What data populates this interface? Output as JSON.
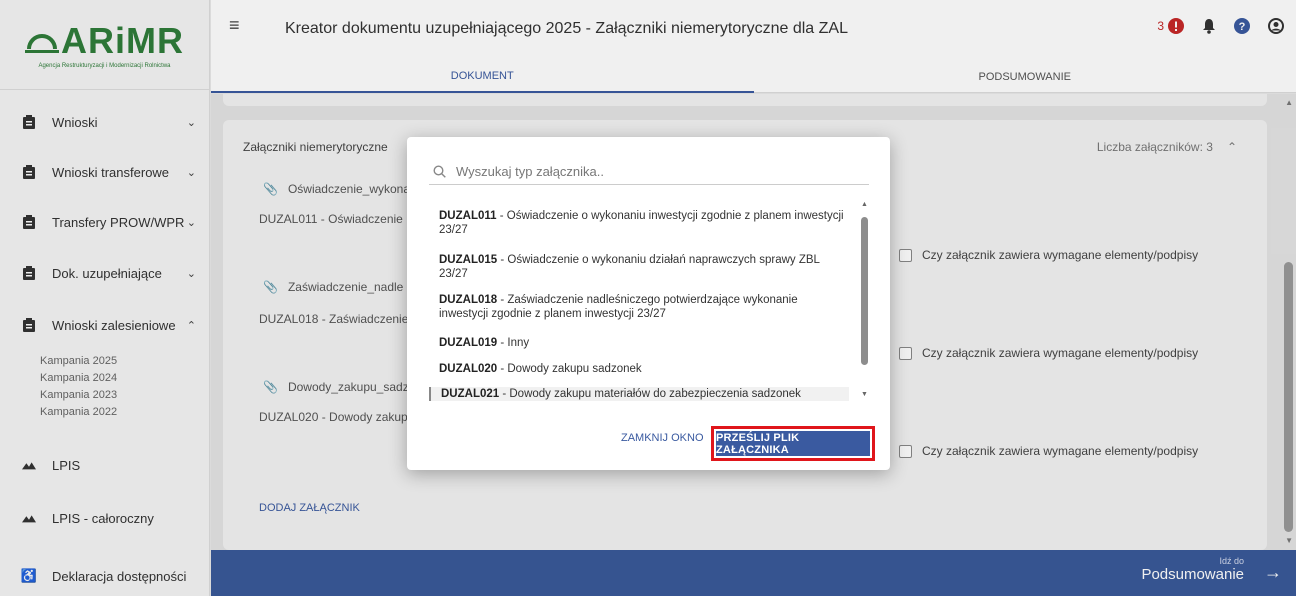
{
  "logo": {
    "text": "ARiMR",
    "subtitle": "Agencja Restrukturyzacji i Modernizacji Rolnictwa"
  },
  "header": {
    "title": "Kreator dokumentu uzupełniającego 2025 - Załączniki niemerytoryczne dla ZAL",
    "notification_count": "3"
  },
  "tabs": [
    {
      "label": "DOKUMENT"
    },
    {
      "label": "PODSUMOWANIE"
    }
  ],
  "sidebar": {
    "items": [
      {
        "label": "Wnioski",
        "icon": "clipboard-icon"
      },
      {
        "label": "Wnioski transferowe",
        "icon": "clipboard-icon"
      },
      {
        "label": "Transfery PROW/WPR",
        "icon": "clipboard-icon"
      },
      {
        "label": "Dok. uzupełniające",
        "icon": "clipboard-icon"
      },
      {
        "label": "Wnioski zalesieniowe",
        "icon": "clipboard-icon"
      },
      {
        "label": "LPIS",
        "icon": "mountain-icon"
      },
      {
        "label": "LPIS - całoroczny",
        "icon": "mountain-icon"
      },
      {
        "label": "Deklaracja dostępności",
        "icon": "accessibility-icon"
      }
    ],
    "subitems": [
      "Kampania 2025",
      "Kampania 2024",
      "Kampania 2023",
      "Kampania 2022"
    ]
  },
  "card": {
    "title": "Załączniki niemerytoryczne",
    "count_label": "Liczba załączników: 3",
    "files": [
      {
        "name": "Oświadczenie_wykona",
        "type": "DUZAL011 - Oświadczenie"
      },
      {
        "name": "Zaświadczenie_nadle",
        "type": "DUZAL018 - Zaświadczenie"
      },
      {
        "name": "Dowody_zakupu_sadz",
        "type": "DUZAL020 - Dowody zakup"
      }
    ],
    "checkbox_label": "Czy załącznik zawiera wymagane elementy/podpisy",
    "add_label": "DODAJ ZAŁĄCZNIK"
  },
  "bottom": {
    "small": "Idź do",
    "main": "Podsumowanie"
  },
  "modal": {
    "search_placeholder": "Wyszukaj typ załącznika..",
    "options": [
      {
        "code": "DUZAL011",
        "text": " - Oświadczenie o wykonaniu inwestycji zgodnie z planem inwestycji 23/27"
      },
      {
        "code": "DUZAL015",
        "text": " - Oświadczenie o wykonaniu działań naprawczych sprawy ZBL 23/27"
      },
      {
        "code": "DUZAL018",
        "text": " - Zaświadczenie nadleśniczego potwierdzające wykonanie inwestycji zgodnie z planem inwestycji 23/27"
      },
      {
        "code": "DUZAL019",
        "text": " - Inny"
      },
      {
        "code": "DUZAL020",
        "text": " - Dowody zakupu sadzonek"
      },
      {
        "code": "DUZAL021",
        "text": " - Dowody zakupu materiałów do zabezpieczenia sadzonek"
      }
    ],
    "close_label": "ZAMKNIJ OKNO",
    "upload_label": "PRZEŚLIJ PLIK ZAŁĄCZNIKA"
  }
}
